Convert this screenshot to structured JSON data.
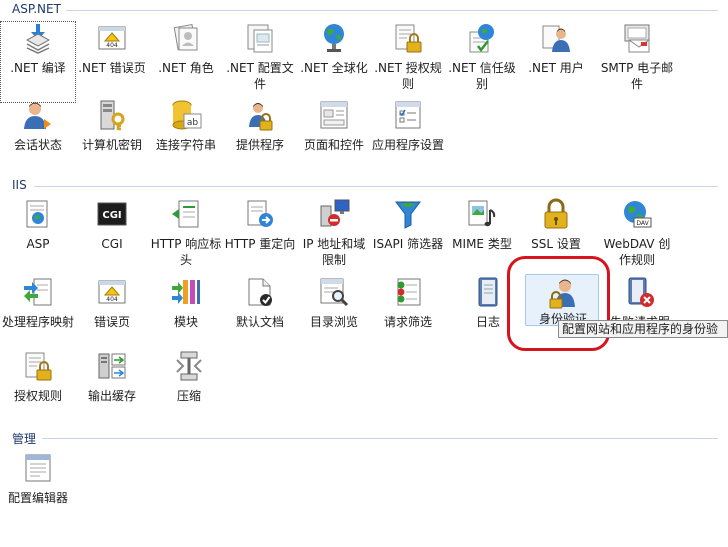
{
  "sections": {
    "aspnet": {
      "title": "ASP.NET"
    },
    "iis": {
      "title": "IIS"
    },
    "manage": {
      "title": "管理"
    }
  },
  "aspnet_items": [
    {
      "label": ".NET 编译",
      "icon": "compile-icon"
    },
    {
      "label": ".NET 错误页",
      "icon": "error-page-404-icon"
    },
    {
      "label": ".NET 角色",
      "icon": "roles-icon"
    },
    {
      "label": ".NET 配置文件",
      "icon": "profile-icon"
    },
    {
      "label": ".NET 全球化",
      "icon": "globe-icon"
    },
    {
      "label": ".NET 授权规则",
      "icon": "authorization-lock-icon"
    },
    {
      "label": ".NET 信任级别",
      "icon": "trust-level-icon"
    },
    {
      "label": ".NET 用户",
      "icon": "users-icon"
    },
    {
      "label": "SMTP 电子邮件",
      "icon": "smtp-email-icon"
    },
    {
      "label": "会话状态",
      "icon": "session-state-icon"
    },
    {
      "label": "计算机密钥",
      "icon": "machine-key-icon"
    },
    {
      "label": "连接字符串",
      "icon": "connection-string-icon"
    },
    {
      "label": "提供程序",
      "icon": "providers-icon"
    },
    {
      "label": "页面和控件",
      "icon": "pages-controls-icon"
    },
    {
      "label": "应用程序设置",
      "icon": "app-settings-icon"
    }
  ],
  "iis_items": [
    {
      "label": "ASP",
      "icon": "asp-icon"
    },
    {
      "label": "CGI",
      "icon": "cgi-icon"
    },
    {
      "label": "HTTP 响应标头",
      "icon": "http-headers-icon"
    },
    {
      "label": "HTTP 重定向",
      "icon": "http-redirect-icon"
    },
    {
      "label": "IP 地址和域限制",
      "icon": "ip-restrictions-icon"
    },
    {
      "label": "ISAPI 筛选器",
      "icon": "isapi-filters-icon"
    },
    {
      "label": "MIME 类型",
      "icon": "mime-types-icon"
    },
    {
      "label": "SSL 设置",
      "icon": "ssl-lock-icon"
    },
    {
      "label": "WebDAV 创作规则",
      "icon": "webdav-icon"
    },
    {
      "label": "处理程序映射",
      "icon": "handler-mappings-icon"
    },
    {
      "label": "错误页",
      "icon": "error-pages-404-icon"
    },
    {
      "label": "模块",
      "icon": "modules-icon"
    },
    {
      "label": "默认文档",
      "icon": "default-document-icon"
    },
    {
      "label": "目录浏览",
      "icon": "directory-browsing-icon"
    },
    {
      "label": "请求筛选",
      "icon": "request-filtering-icon"
    },
    {
      "label": "日志",
      "icon": "logging-icon"
    },
    {
      "label": "身份验证",
      "icon": "authentication-icon"
    },
    {
      "label": "失败请求跟",
      "icon": "failed-request-tracing-icon"
    },
    {
      "label": "授权规则",
      "icon": "authorization-rules-icon"
    },
    {
      "label": "输出缓存",
      "icon": "output-caching-icon"
    },
    {
      "label": "压缩",
      "icon": "compression-icon"
    }
  ],
  "manage_items": [
    {
      "label": "配置编辑器",
      "icon": "configuration-editor-icon"
    }
  ],
  "tooltip": {
    "text": "配置网站和应用程序的身份验"
  },
  "colors": {
    "accent": "#1e3a6e",
    "annotation": "#d7131b",
    "hover": "#e7f1fb"
  }
}
